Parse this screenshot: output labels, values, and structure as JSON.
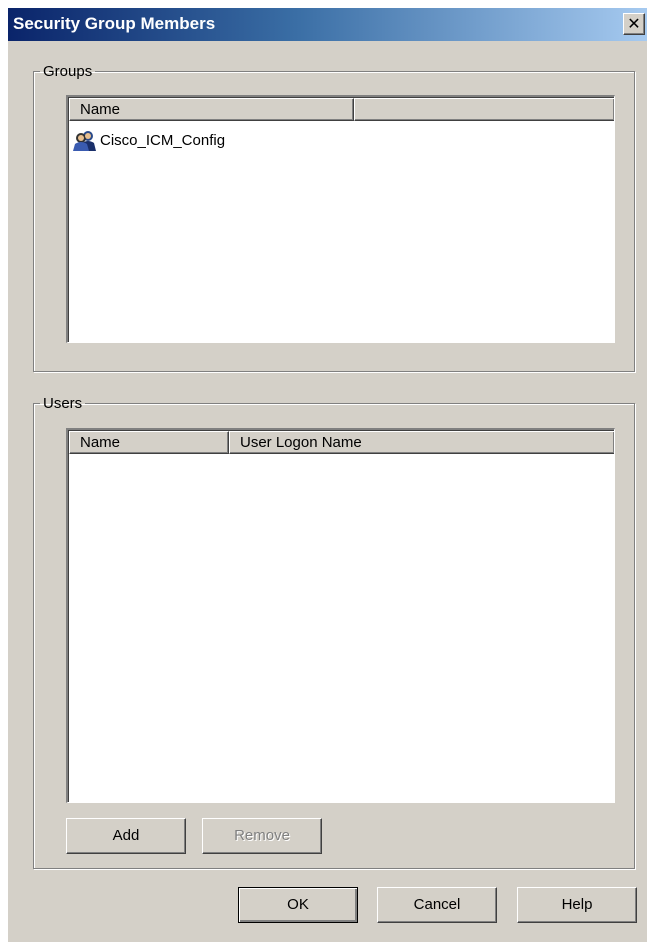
{
  "window": {
    "title": "Security Group Members"
  },
  "groups": {
    "legend": "Groups",
    "columns": [
      "Name",
      ""
    ],
    "rows": [
      {
        "name": "Cisco_ICM_Config",
        "icon": "group-icon"
      }
    ]
  },
  "users": {
    "legend": "Users",
    "columns": [
      "Name",
      "User Logon Name"
    ],
    "rows": []
  },
  "buttons": {
    "add": "Add",
    "remove": "Remove",
    "ok": "OK",
    "cancel": "Cancel",
    "help": "Help"
  },
  "colors": {
    "face": "#d4d0c8",
    "titlebar_start": "#0a246a",
    "titlebar_end": "#a6caf0"
  }
}
